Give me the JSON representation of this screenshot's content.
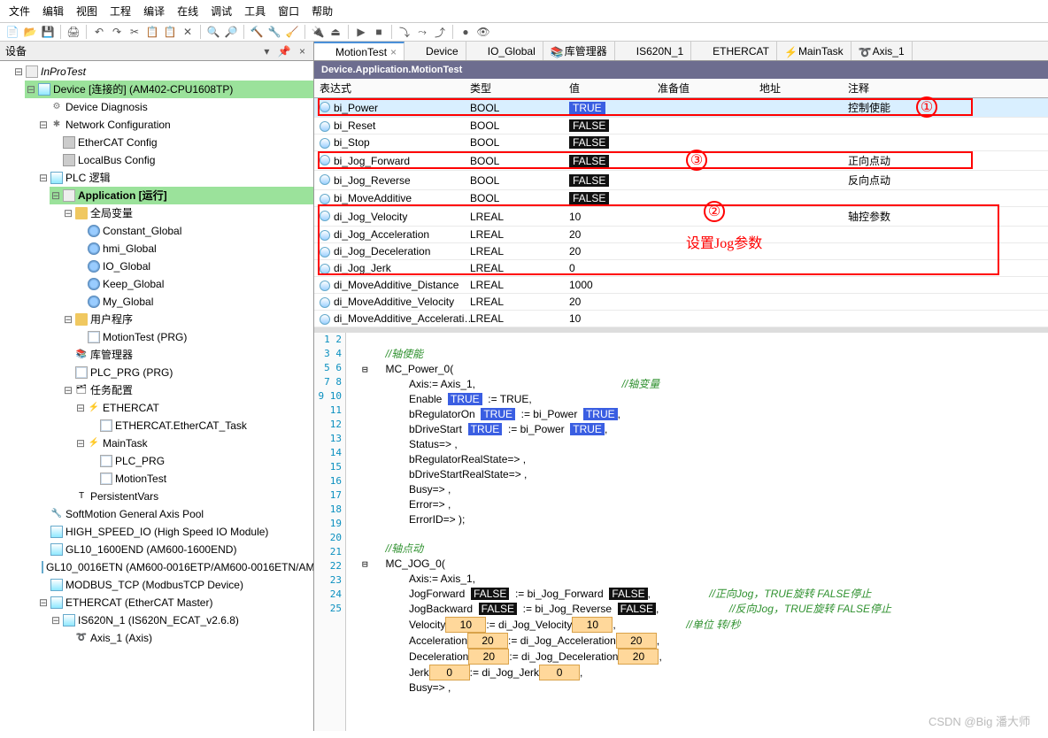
{
  "menu": [
    "文件",
    "编辑",
    "视图",
    "工程",
    "编译",
    "在线",
    "调试",
    "工具",
    "窗口",
    "帮助"
  ],
  "panel": {
    "title": "设备",
    "pin": "📌",
    "close": "×",
    "arrow": "▾"
  },
  "tree": {
    "root": "InProTest",
    "device": "Device [连接的] (AM402-CPU1608TP)",
    "diag": "Device Diagnosis",
    "netcfg": "Network Configuration",
    "ethercat": "EtherCAT Config",
    "localbus": "LocalBus Config",
    "plc": "PLC 逻辑",
    "app": "Application [运行]",
    "glob": "全局变量",
    "g1": "Constant_Global",
    "g2": "hmi_Global",
    "g3": "IO_Global",
    "g4": "Keep_Global",
    "g5": "My_Global",
    "user": "用户程序",
    "mt": "MotionTest (PRG)",
    "lib": "库管理器",
    "plcprg": "PLC_PRG (PRG)",
    "taskcfg": "任务配置",
    "teth": "ETHERCAT",
    "tethtask": "ETHERCAT.EtherCAT_Task",
    "tmain": "MainTask",
    "tplc": "PLC_PRG",
    "tmt": "MotionTest",
    "pv": "PersistentVars",
    "softm": "SoftMotion General Axis Pool",
    "hsio": "HIGH_SPEED_IO (High Speed IO Module)",
    "gl10": "GL10_1600END (AM600-1600END)",
    "gl16": "GL10_0016ETN (AM600-0016ETP/AM600-0016ETN/AM",
    "modbus": "MODBUS_TCP (ModbusTCP Device)",
    "ethm": "ETHERCAT (EtherCAT Master)",
    "is620": "IS620N_1 (IS620N_ECAT_v2.6.8)",
    "axis": "Axis_1 (Axis)"
  },
  "tabs": [
    {
      "label": "MotionTest",
      "active": true,
      "close": "×"
    },
    {
      "label": "Device"
    },
    {
      "label": "IO_Global"
    },
    {
      "label": "库管理器"
    },
    {
      "label": "IS620N_1"
    },
    {
      "label": "ETHERCAT"
    },
    {
      "label": "MainTask"
    },
    {
      "label": "Axis_1"
    }
  ],
  "crumb": "Device.Application.MotionTest",
  "watch_headers": [
    "表达式",
    "类型",
    "值",
    "准备值",
    "地址",
    "注释"
  ],
  "watch": [
    {
      "name": "bi_Power",
      "type": "BOOL",
      "val": "TRUE",
      "comment": "控制使能",
      "sel": true
    },
    {
      "name": "bi_Reset",
      "type": "BOOL",
      "val": "FALSE",
      "comment": ""
    },
    {
      "name": "bi_Stop",
      "type": "BOOL",
      "val": "FALSE",
      "comment": ""
    },
    {
      "name": "bi_Jog_Forward",
      "type": "BOOL",
      "val": "FALSE",
      "comment": "正向点动"
    },
    {
      "name": "bi_Jog_Reverse",
      "type": "BOOL",
      "val": "FALSE",
      "comment": "反向点动"
    },
    {
      "name": "bi_MoveAdditive",
      "type": "BOOL",
      "val": "FALSE",
      "comment": ""
    },
    {
      "name": "di_Jog_Velocity",
      "type": "LREAL",
      "val": "10",
      "comment": "轴控参数"
    },
    {
      "name": "di_Jog_Acceleration",
      "type": "LREAL",
      "val": "20",
      "comment": ""
    },
    {
      "name": "di_Jog_Deceleration",
      "type": "LREAL",
      "val": "20",
      "comment": ""
    },
    {
      "name": "di_Jog_Jerk",
      "type": "LREAL",
      "val": "0",
      "comment": ""
    },
    {
      "name": "di_MoveAdditive_Distance",
      "type": "LREAL",
      "val": "1000",
      "comment": ""
    },
    {
      "name": "di_MoveAdditive_Velocity",
      "type": "LREAL",
      "val": "20",
      "comment": ""
    },
    {
      "name": "di_MoveAdditive_Accelerati…",
      "type": "LREAL",
      "val": "10",
      "comment": ""
    }
  ],
  "annots": {
    "n1": "①",
    "n2": "②",
    "n3": "③",
    "jog": "设置Jog参数"
  },
  "code": {
    "c1": "//轴使能",
    "c2": "MC_Power_0(",
    "c3": "Axis:= Axis_1,",
    "c3c": "//轴变量",
    "c4a": "Enable",
    "c4b": ":= TRUE,",
    "c5a": "bRegulatorOn",
    "c5b": ":= bi_Power",
    "c5c": ",",
    "c6a": "bDriveStart",
    "c6b": ":= bi_Power",
    "c6c": ",",
    "c7": "Status=> ,",
    "c8": "bRegulatorRealState=> ,",
    "c9": "bDriveStartRealState=> ,",
    "c10": "Busy=> ,",
    "c11": "Error=> ,",
    "c12": "ErrorID=> );",
    "c13": "//轴点动",
    "c14": "MC_JOG_0(",
    "c15": "Axis:= Axis_1,",
    "c16a": "JogForward",
    "c16b": ":= bi_Jog_Forward",
    "c16c": ",",
    "c16cm": "//正向Jog，TRUE旋转 FALSE停止",
    "c17a": "JogBackward",
    "c17b": ":= bi_Jog_Reverse",
    "c17c": ",",
    "c17cm": "//反向Jog，TRUE旋转 FALSE停止",
    "c18a": "Velocity",
    "c18b": ":= di_Jog_Velocity",
    "c18c": ",",
    "c18cm": "//单位 转/秒",
    "c18v": "10",
    "c19a": "Acceleration",
    "c19b": ":= di_Jog_Acceleration",
    "c19c": ",",
    "c19v": "20",
    "c20a": "Deceleration",
    "c20b": ":= di_Jog_Deceleration",
    "c20c": ",",
    "c20v": "20",
    "c21a": "Jerk",
    "c21b": ":= di_Jog_Jerk",
    "c21c": ",",
    "c21v": "0",
    "c22": "Busy=> ,",
    "true": "TRUE",
    "false": "FALSE"
  },
  "watermark": "CSDN @Big 潘大师"
}
